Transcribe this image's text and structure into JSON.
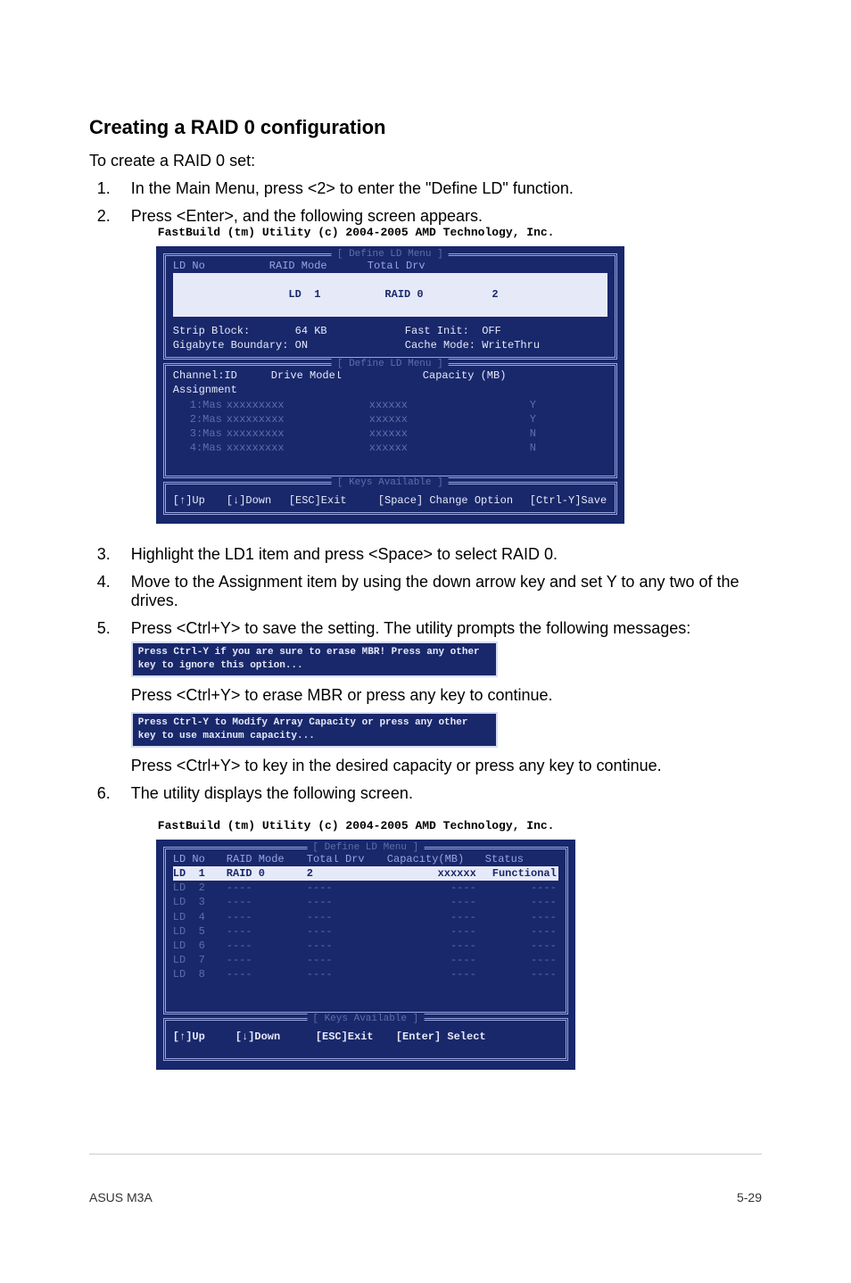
{
  "heading": "Creating a RAID 0 configuration",
  "intro": "To create a RAID 0 set:",
  "steps": {
    "s1": "In the Main Menu, press <2> to enter the \"Define LD\" function.",
    "s2": "Press <Enter>, and the following screen appears.",
    "s3": "Highlight the LD1 item and press <Space> to select RAID 0.",
    "s4": "Move to the Assignment item by using the down arrow key and set Y to any two of the drives.",
    "s5": "Press <Ctrl+Y> to save the setting. The utility prompts the following messages:",
    "s5a": "Press <Ctrl+Y> to erase MBR or press any key to continue.",
    "s5b": "Press <Ctrl+Y> to key in the desired capacity or press any key to continue.",
    "s6": "The utility displays the following screen."
  },
  "msg1": "Press Ctrl-Y if you are sure to erase MBR! Press any other key to ignore this option...",
  "msg2": "Press Ctrl-Y to Modify Array Capacity or press any other key to use maxinum capacity...",
  "term1": {
    "title": "FastBuild (tm) Utility (c) 2004-2005 AMD Technology, Inc.",
    "panel1_title": "[ Define LD Menu ]",
    "hdr": {
      "ldno": "LD No",
      "raidmode": "RAID Mode",
      "totaldrv": "Total Drv"
    },
    "row1": {
      "ldno": "LD  1",
      "raidmode": "RAID 0",
      "totaldrv": "2"
    },
    "strip": "Strip Block:       64 KB",
    "fastinit": "Fast Init:  OFF",
    "gigabyte": "Gigabyte Boundary: ON",
    "cache": "Cache Mode: WriteThru",
    "panel2_title": "[ Define LD Menu ]",
    "hdr2": {
      "chid": "Channel:ID",
      "drivemodel": "Drive Model",
      "capacity": "Capacity (MB)",
      "assign": "Assignment"
    },
    "rows": [
      {
        "ch": "1:Mas",
        "model": "xxxxxxxxx",
        "cap": "xxxxxx",
        "asg": "Y"
      },
      {
        "ch": "2:Mas",
        "model": "xxxxxxxxx",
        "cap": "xxxxxx",
        "asg": "Y"
      },
      {
        "ch": "3:Mas",
        "model": "xxxxxxxxx",
        "cap": "xxxxxx",
        "asg": "N"
      },
      {
        "ch": "4:Mas",
        "model": "xxxxxxxxx",
        "cap": "xxxxxx",
        "asg": "N"
      }
    ],
    "keys_title": "[ Keys Available ]",
    "footer": {
      "up": "[↑]Up",
      "down": "[↓]Down",
      "esc": "[ESC]Exit",
      "space": "[Space] Change Option",
      "ctrly": "[Ctrl-Y]Save"
    }
  },
  "term2": {
    "title": "FastBuild (tm) Utility (c) 2004-2005 AMD Technology, Inc.",
    "panel_title": "[ Define LD Menu ]",
    "hdr": {
      "ldno": "LD No",
      "raidmode": "RAID Mode",
      "totaldrv": "Total Drv",
      "capacity": "Capacity(MB)",
      "status": "Status"
    },
    "rows": [
      {
        "ldno": "LD  1",
        "raidmode": "RAID 0",
        "totaldrv": "2",
        "capacity": "xxxxxx",
        "status": "Functional",
        "hl": true
      },
      {
        "ldno": "LD  2",
        "raidmode": "----",
        "totaldrv": "----",
        "capacity": "----",
        "status": "----"
      },
      {
        "ldno": "LD  3",
        "raidmode": "----",
        "totaldrv": "----",
        "capacity": "----",
        "status": "----"
      },
      {
        "ldno": "LD  4",
        "raidmode": "----",
        "totaldrv": "----",
        "capacity": "----",
        "status": "----"
      },
      {
        "ldno": "LD  5",
        "raidmode": "----",
        "totaldrv": "----",
        "capacity": "----",
        "status": "----"
      },
      {
        "ldno": "LD  6",
        "raidmode": "----",
        "totaldrv": "----",
        "capacity": "----",
        "status": "----"
      },
      {
        "ldno": "LD  7",
        "raidmode": "----",
        "totaldrv": "----",
        "capacity": "----",
        "status": "----"
      },
      {
        "ldno": "LD  8",
        "raidmode": "----",
        "totaldrv": "----",
        "capacity": "----",
        "status": "----"
      }
    ],
    "keys_title": "[ Keys Available ]",
    "footer": {
      "up": "[↑]Up",
      "down": "[↓]Down",
      "esc": "[ESC]Exit",
      "enter": "[Enter] Select"
    }
  },
  "pagefooter": {
    "left": "ASUS M3A",
    "right": "5-29"
  }
}
